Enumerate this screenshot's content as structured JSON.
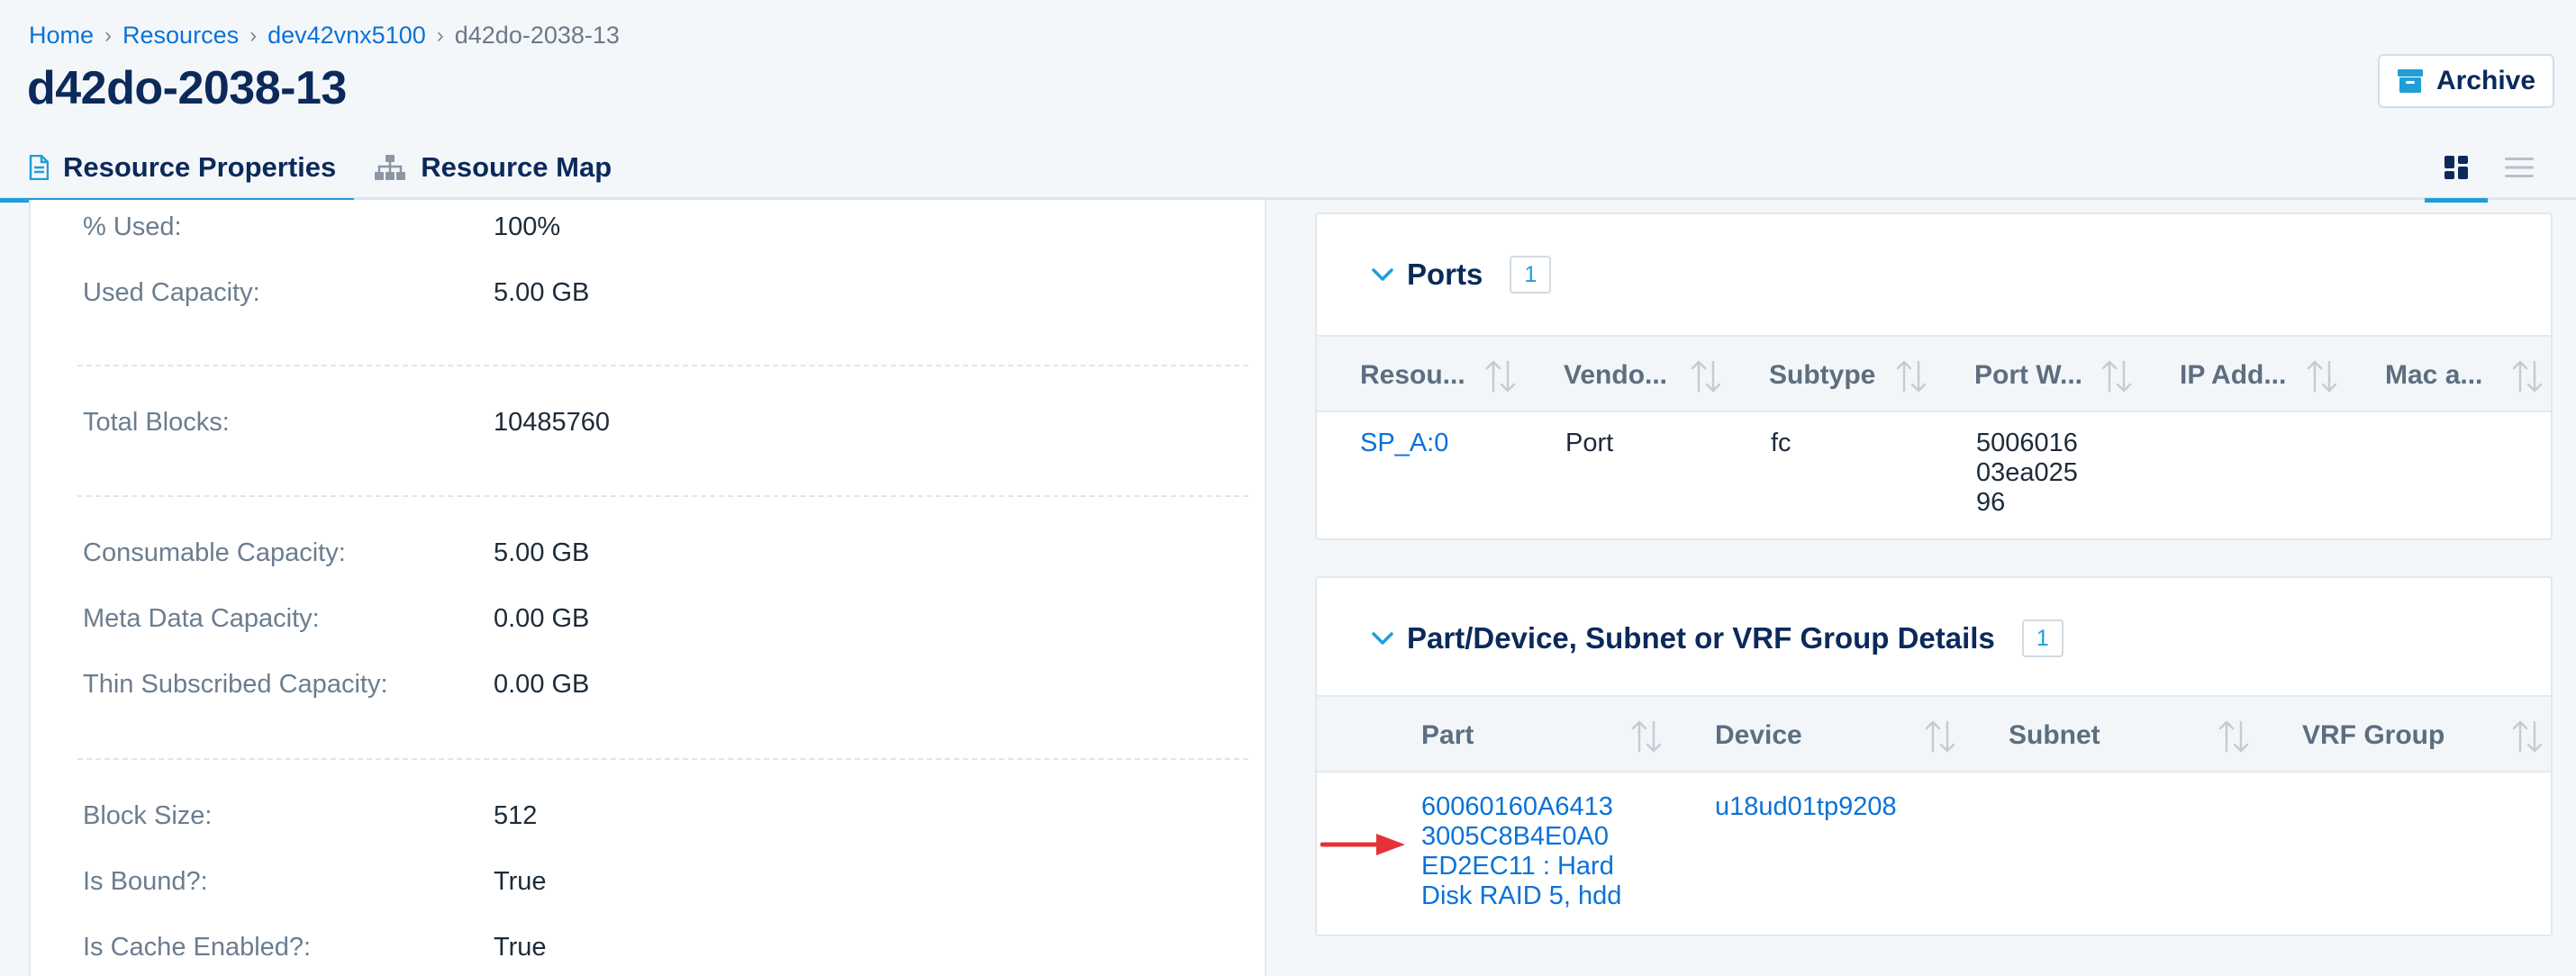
{
  "breadcrumb": {
    "home": "Home",
    "resources": "Resources",
    "parent": "dev42vnx5100",
    "current": "d42do-2038-13",
    "separator": "›"
  },
  "title": "d42do-2038-13",
  "archive_label": "Archive",
  "tabs": {
    "properties": "Resource Properties",
    "map": "Resource Map"
  },
  "properties": [
    {
      "label": "% Used:",
      "value": "100%"
    },
    {
      "label": "Used Capacity:",
      "value": "5.00 GB"
    },
    {
      "label": "Total Blocks:",
      "value": "10485760"
    },
    {
      "label": "Consumable Capacity:",
      "value": "5.00 GB"
    },
    {
      "label": "Meta Data Capacity:",
      "value": "0.00 GB"
    },
    {
      "label": "Thin Subscribed Capacity:",
      "value": "0.00 GB"
    },
    {
      "label": "Block Size:",
      "value": "512"
    },
    {
      "label": "Is Bound?:",
      "value": "True"
    },
    {
      "label": "Is Cache Enabled?:",
      "value": "True"
    }
  ],
  "ports": {
    "title": "Ports",
    "count": "1",
    "columns": [
      "Resou...",
      "Vendo...",
      "Subtype",
      "Port W...",
      "IP Add...",
      "Mac a..."
    ],
    "row": {
      "resource": "SP_A:0",
      "vendor": "Port",
      "subtype": "fc",
      "wwn_lines": [
        "5006016",
        "03ea025",
        "96"
      ]
    }
  },
  "part_device": {
    "title": "Part/Device, Subnet or VRF Group Details",
    "count": "1",
    "columns": [
      "Part",
      "Device",
      "Subnet",
      "VRF Group"
    ],
    "row": {
      "part_lines": [
        "60060160A6413",
        "3005C8B4E0A0",
        "ED2EC11 : Hard",
        "Disk RAID 5, hdd"
      ],
      "device": "u18ud01tp9208"
    }
  },
  "colors": {
    "navy": "#0b2a5b",
    "link": "#0a72d8",
    "accent": "#1f9ed8",
    "arrow": "#e53238"
  },
  "icons": [
    "document-icon",
    "sitemap-icon",
    "archive-box-icon",
    "grid-view-icon",
    "list-view-icon",
    "chevron-down-icon",
    "sort-icon",
    "red-arrow-icon"
  ]
}
